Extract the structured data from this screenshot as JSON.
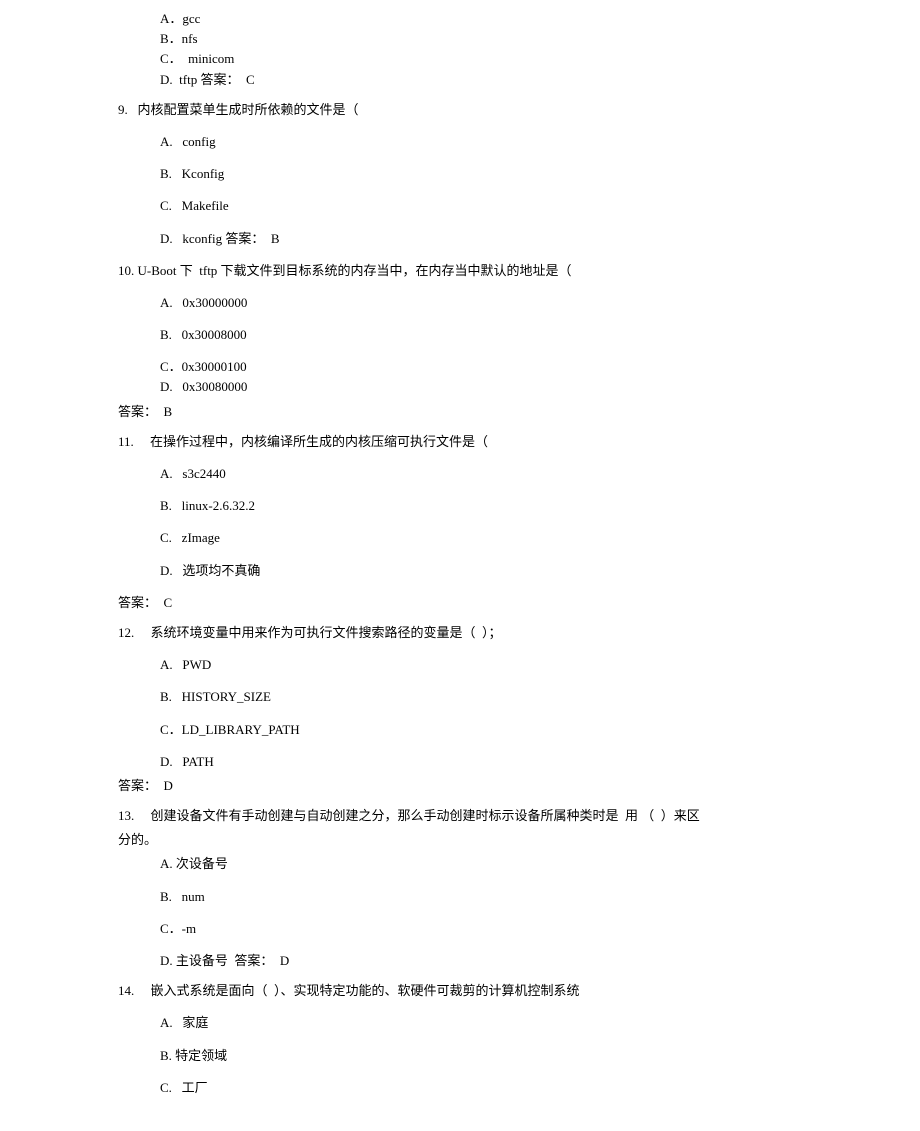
{
  "q8opts": {
    "a": "A．gcc",
    "b": "B．nfs",
    "c": "C．  minicom",
    "d": "D.  tftp 答案：  C"
  },
  "q9": {
    "text": "9.   内核配置菜单生成时所依赖的文件是（",
    "a": "A.   config",
    "b": "B.   Kconfig",
    "c": "C.   Makefile",
    "d": "D.   kconfig 答案：  B"
  },
  "q10": {
    "text": "10. U-Boot 下  tftp 下载文件到目标系统的内存当中，在内存当中默认的地址是（",
    "a": "A.   0x30000000",
    "b": "B.   0x30008000",
    "c": "C．0x30000100",
    "d": "D.   0x30080000",
    "ans": "答案：  B"
  },
  "q11": {
    "text": "11.     在操作过程中，内核编译所生成的内核压缩可执行文件是（",
    "a": "A.   s3c2440",
    "b": "B.   linux-2.6.32.2",
    "c": "C.   zImage",
    "d": "D.   选项均不真确",
    "ans": "答案：  C"
  },
  "q12": {
    "text": "12.     系统环境变量中用来作为可执行文件搜索路径的变量是（  ）；",
    "a": "A.   PWD",
    "b": "B.   HISTORY_SIZE",
    "c": "C．LD_LIBRARY_PATH",
    "d": "D.   PATH",
    "ans": "答案：  D"
  },
  "q13": {
    "text1": "13.     创建设备文件有手动创建与自动创建之分，那么手动创建时标示设备所属种类时是  用 （  ）来区",
    "text2": "分的。",
    "a": "A. 次设备号",
    "b": "B.   num",
    "c": "C．-m",
    "d": "D. 主设备号  答案：  D"
  },
  "q14": {
    "text": "14.     嵌入式系统是面向（  ）、实现特定功能的、软硬件可裁剪的计算机控制系统",
    "a": "A.   家庭",
    "b": "B. 特定领域",
    "c": "C.   工厂"
  }
}
